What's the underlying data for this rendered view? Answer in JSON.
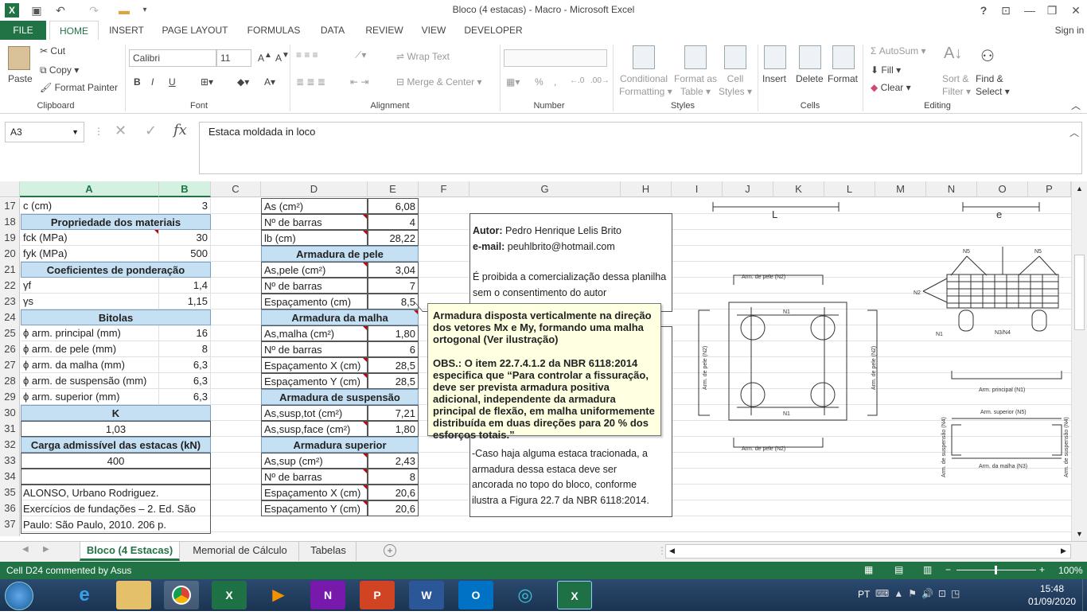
{
  "window": {
    "title": "Bloco (4 estacas) - Macro - Microsoft Excel",
    "help": "?",
    "signin": "Sign in"
  },
  "ribbon_tabs": [
    "FILE",
    "HOME",
    "INSERT",
    "PAGE LAYOUT",
    "FORMULAS",
    "DATA",
    "REVIEW",
    "VIEW",
    "DEVELOPER"
  ],
  "clipboard": {
    "paste": "Paste",
    "cut": "Cut",
    "copy": "Copy",
    "format_painter": "Format Painter",
    "label": "Clipboard"
  },
  "font": {
    "name": "Calibri",
    "size": "11",
    "label": "Font",
    "bold": "B",
    "italic": "I",
    "underline": "U"
  },
  "alignment": {
    "wrap": "Wrap Text",
    "merge": "Merge & Center",
    "label": "Alignment"
  },
  "number": {
    "label": "Number",
    "percent": "%"
  },
  "styles": {
    "cond1": "Conditional",
    "cond2": "Formatting",
    "fmt1": "Format as",
    "fmt2": "Table",
    "cell1": "Cell",
    "cell2": "Styles",
    "label": "Styles"
  },
  "cells": {
    "insert": "Insert",
    "delete": "Delete",
    "format": "Format",
    "label": "Cells"
  },
  "editing": {
    "autosum": "AutoSum",
    "fill": "Fill",
    "clear": "Clear",
    "sort1": "Sort &",
    "sort2": "Filter",
    "find1": "Find &",
    "find2": "Select",
    "label": "Editing"
  },
  "formula_bar": {
    "name_box": "A3",
    "content": "Estaca moldada in loco",
    "fx": "fx"
  },
  "columns": [
    "A",
    "B",
    "C",
    "D",
    "E",
    "F",
    "G",
    "H",
    "I",
    "J",
    "K",
    "L",
    "M",
    "N",
    "O",
    "P"
  ],
  "rows": [
    "17",
    "18",
    "19",
    "20",
    "21",
    "22",
    "23",
    "24",
    "25",
    "26",
    "27",
    "28",
    "29",
    "30",
    "31",
    "32",
    "33",
    "34",
    "35",
    "36",
    "37"
  ],
  "table_ab": [
    [
      "c (cm)",
      "3"
    ],
    [
      "Propriedade dos materiais",
      ""
    ],
    [
      "fck (MPa)",
      "30"
    ],
    [
      "fyk (MPa)",
      "500"
    ],
    [
      "Coeficientes de ponderação",
      ""
    ],
    [
      "γf",
      "1,4"
    ],
    [
      "γs",
      "1,15"
    ],
    [
      "Bitolas",
      ""
    ],
    [
      "ϕ arm. principal (mm)",
      "16"
    ],
    [
      "ϕ arm. de pele (mm)",
      "8"
    ],
    [
      "ϕ arm. da malha (mm)",
      "6,3"
    ],
    [
      "ϕ arm. de suspensão (mm)",
      "6,3"
    ],
    [
      "ϕ arm. superior (mm)",
      "6,3"
    ],
    [
      "K",
      ""
    ],
    [
      "1,03",
      ""
    ],
    [
      "Carga admissível das estacas (kN)",
      ""
    ],
    [
      "400",
      ""
    ]
  ],
  "reference": {
    "line1": "ALONSO, Urbano Rodriguez.",
    "line2": "Exercícios de fundações – 2. Ed. São",
    "line3": "Paulo: São Paulo, 2010. 206 p."
  },
  "table_de": [
    [
      "As (cm²)",
      "6,08"
    ],
    [
      "Nº de barras",
      "4"
    ],
    [
      "lb (cm)",
      "28,22"
    ],
    [
      "Armadura de pele",
      ""
    ],
    [
      "As,pele (cm²)",
      "3,04"
    ],
    [
      "Nº de barras",
      "7"
    ],
    [
      "Espaçamento (cm)",
      "8,5"
    ],
    [
      "Armadura da malha",
      ""
    ],
    [
      "As,malha (cm²)",
      "1,80"
    ],
    [
      "Nº de barras",
      "6"
    ],
    [
      "Espaçamento X (cm)",
      "28,5"
    ],
    [
      "Espaçamento Y (cm)",
      "28,5"
    ],
    [
      "Armadura de suspensão",
      ""
    ],
    [
      "As,susp,tot (cm²)",
      "7,21"
    ],
    [
      "As,susp,face (cm²)",
      "1,80"
    ],
    [
      "Armadura superior",
      ""
    ],
    [
      "As,sup (cm²)",
      "2,43"
    ],
    [
      "Nº de barras",
      "8"
    ],
    [
      "Espaçamento X (cm)",
      "20,6"
    ],
    [
      "Espaçamento Y (cm)",
      "20,6"
    ]
  ],
  "author_box": {
    "autor_label": "Autor:",
    "autor": "Pedro Henrique Lelis Brito",
    "email_label": "e-mail:",
    "email": "peuhlbrito@hotmail.com",
    "note1": "É proibida a comercialização dessa planilha",
    "note2": "sem o consentimento do autor"
  },
  "lower_box": {
    "l1": "-Caso haja alguma estaca tracionada, a",
    "l2": "armadura dessa estaca deve ser",
    "l3": "ancorada no topo do bloco, conforme",
    "l4": "ilustra a Figura 22.7 da NBR 6118:2014."
  },
  "comment": {
    "p1": "Armadura disposta verticalmente na direção dos vetores Mx e My, formando uma malha ortogonal (Ver ilustração)",
    "p2": "OBS.: O item 22.7.4.1.2 da NBR 6118:2014 especifica que “Para controlar a fissuração, deve ser prevista armadura positiva adicional, independente da armadura principal de flexão, em malha uniformemente distribuída em duas direções para 20 % dos esforços totais.”"
  },
  "drawing": {
    "L": "L",
    "e": "e",
    "arm_pele": "Arm. de pele (N2)",
    "N1": "N1",
    "N2": "N2",
    "N5": "N5",
    "N3N4": "N3/N4",
    "arm_principal": "Arm. principal (N1)",
    "arm_superior": "Arm. superior (N5)",
    "arm_susp": "Arm. de suspensão (N4)",
    "arm_malha": "Arm. da malha (N3)"
  },
  "sheets": [
    "Bloco (4 Estacas)",
    "Memorial de Cálculo",
    "Tabelas"
  ],
  "status": {
    "text": "Cell D24 commented by Asus",
    "zoom": "100%"
  },
  "taskbar": {
    "lang": "PT",
    "time": "15:48",
    "date": "01/09/2020"
  }
}
